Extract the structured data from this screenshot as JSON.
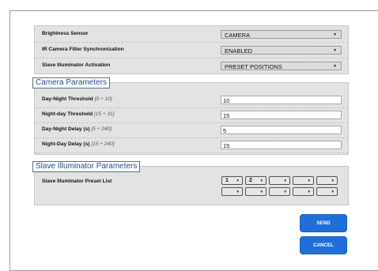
{
  "general_settings": [
    {
      "label": "Brightness Sensor",
      "value": "CAMERA"
    },
    {
      "label": "IR Camera Filter Synchronization",
      "value": "ENABLED"
    },
    {
      "label": "Slave Illuminator Activation",
      "value": "PRESET POSITIONS"
    }
  ],
  "camera_parameters": {
    "title": "Camera Parameters",
    "fields": [
      {
        "label": "Day-Night Threshold",
        "range": "[0 ÷ 10]",
        "value": "10"
      },
      {
        "label": "Night-day Threshold",
        "range": "[15 ÷ 31]",
        "value": "15"
      },
      {
        "label": "Day-Night Delay (s)",
        "range": "[5 ÷ 240]",
        "value": "5"
      },
      {
        "label": "Night-Day Delay (s)",
        "range": "[15 ÷ 240]",
        "value": "15"
      }
    ]
  },
  "slave_illuminator": {
    "title": "Slave Illuminator Parameters",
    "preset_label": "Slave Illuminator Preset List",
    "presets": [
      "1",
      "2",
      "",
      "",
      "",
      "",
      "",
      "",
      "",
      ""
    ]
  },
  "icons": {
    "dropdown_arrow": "▼"
  },
  "buttons": {
    "send": "SEND",
    "cancel": "CANCEL"
  },
  "colors": {
    "button": "#1e6fd8",
    "legend_text": "#1f4f8a",
    "panel_bg": "#e3e3e3"
  }
}
